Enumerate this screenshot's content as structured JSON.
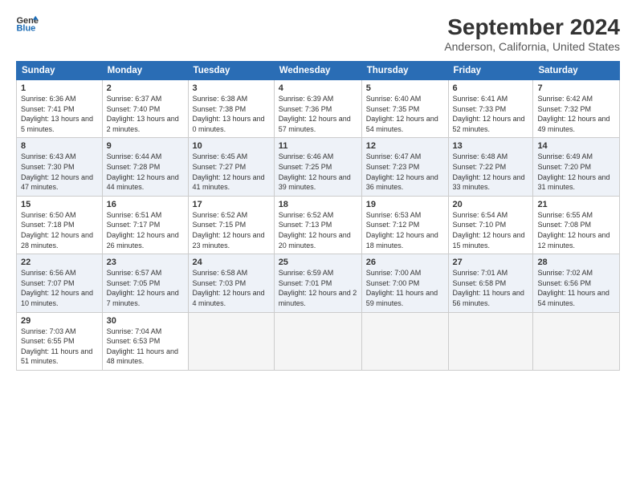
{
  "header": {
    "logo_line1": "General",
    "logo_line2": "Blue",
    "title": "September 2024",
    "subtitle": "Anderson, California, United States"
  },
  "days_of_week": [
    "Sunday",
    "Monday",
    "Tuesday",
    "Wednesday",
    "Thursday",
    "Friday",
    "Saturday"
  ],
  "weeks": [
    [
      {
        "num": "1",
        "sunrise": "Sunrise: 6:36 AM",
        "sunset": "Sunset: 7:41 PM",
        "daylight": "Daylight: 13 hours and 5 minutes."
      },
      {
        "num": "2",
        "sunrise": "Sunrise: 6:37 AM",
        "sunset": "Sunset: 7:40 PM",
        "daylight": "Daylight: 13 hours and 2 minutes."
      },
      {
        "num": "3",
        "sunrise": "Sunrise: 6:38 AM",
        "sunset": "Sunset: 7:38 PM",
        "daylight": "Daylight: 13 hours and 0 minutes."
      },
      {
        "num": "4",
        "sunrise": "Sunrise: 6:39 AM",
        "sunset": "Sunset: 7:36 PM",
        "daylight": "Daylight: 12 hours and 57 minutes."
      },
      {
        "num": "5",
        "sunrise": "Sunrise: 6:40 AM",
        "sunset": "Sunset: 7:35 PM",
        "daylight": "Daylight: 12 hours and 54 minutes."
      },
      {
        "num": "6",
        "sunrise": "Sunrise: 6:41 AM",
        "sunset": "Sunset: 7:33 PM",
        "daylight": "Daylight: 12 hours and 52 minutes."
      },
      {
        "num": "7",
        "sunrise": "Sunrise: 6:42 AM",
        "sunset": "Sunset: 7:32 PM",
        "daylight": "Daylight: 12 hours and 49 minutes."
      }
    ],
    [
      {
        "num": "8",
        "sunrise": "Sunrise: 6:43 AM",
        "sunset": "Sunset: 7:30 PM",
        "daylight": "Daylight: 12 hours and 47 minutes."
      },
      {
        "num": "9",
        "sunrise": "Sunrise: 6:44 AM",
        "sunset": "Sunset: 7:28 PM",
        "daylight": "Daylight: 12 hours and 44 minutes."
      },
      {
        "num": "10",
        "sunrise": "Sunrise: 6:45 AM",
        "sunset": "Sunset: 7:27 PM",
        "daylight": "Daylight: 12 hours and 41 minutes."
      },
      {
        "num": "11",
        "sunrise": "Sunrise: 6:46 AM",
        "sunset": "Sunset: 7:25 PM",
        "daylight": "Daylight: 12 hours and 39 minutes."
      },
      {
        "num": "12",
        "sunrise": "Sunrise: 6:47 AM",
        "sunset": "Sunset: 7:23 PM",
        "daylight": "Daylight: 12 hours and 36 minutes."
      },
      {
        "num": "13",
        "sunrise": "Sunrise: 6:48 AM",
        "sunset": "Sunset: 7:22 PM",
        "daylight": "Daylight: 12 hours and 33 minutes."
      },
      {
        "num": "14",
        "sunrise": "Sunrise: 6:49 AM",
        "sunset": "Sunset: 7:20 PM",
        "daylight": "Daylight: 12 hours and 31 minutes."
      }
    ],
    [
      {
        "num": "15",
        "sunrise": "Sunrise: 6:50 AM",
        "sunset": "Sunset: 7:18 PM",
        "daylight": "Daylight: 12 hours and 28 minutes."
      },
      {
        "num": "16",
        "sunrise": "Sunrise: 6:51 AM",
        "sunset": "Sunset: 7:17 PM",
        "daylight": "Daylight: 12 hours and 26 minutes."
      },
      {
        "num": "17",
        "sunrise": "Sunrise: 6:52 AM",
        "sunset": "Sunset: 7:15 PM",
        "daylight": "Daylight: 12 hours and 23 minutes."
      },
      {
        "num": "18",
        "sunrise": "Sunrise: 6:52 AM",
        "sunset": "Sunset: 7:13 PM",
        "daylight": "Daylight: 12 hours and 20 minutes."
      },
      {
        "num": "19",
        "sunrise": "Sunrise: 6:53 AM",
        "sunset": "Sunset: 7:12 PM",
        "daylight": "Daylight: 12 hours and 18 minutes."
      },
      {
        "num": "20",
        "sunrise": "Sunrise: 6:54 AM",
        "sunset": "Sunset: 7:10 PM",
        "daylight": "Daylight: 12 hours and 15 minutes."
      },
      {
        "num": "21",
        "sunrise": "Sunrise: 6:55 AM",
        "sunset": "Sunset: 7:08 PM",
        "daylight": "Daylight: 12 hours and 12 minutes."
      }
    ],
    [
      {
        "num": "22",
        "sunrise": "Sunrise: 6:56 AM",
        "sunset": "Sunset: 7:07 PM",
        "daylight": "Daylight: 12 hours and 10 minutes."
      },
      {
        "num": "23",
        "sunrise": "Sunrise: 6:57 AM",
        "sunset": "Sunset: 7:05 PM",
        "daylight": "Daylight: 12 hours and 7 minutes."
      },
      {
        "num": "24",
        "sunrise": "Sunrise: 6:58 AM",
        "sunset": "Sunset: 7:03 PM",
        "daylight": "Daylight: 12 hours and 4 minutes."
      },
      {
        "num": "25",
        "sunrise": "Sunrise: 6:59 AM",
        "sunset": "Sunset: 7:01 PM",
        "daylight": "Daylight: 12 hours and 2 minutes."
      },
      {
        "num": "26",
        "sunrise": "Sunrise: 7:00 AM",
        "sunset": "Sunset: 7:00 PM",
        "daylight": "Daylight: 11 hours and 59 minutes."
      },
      {
        "num": "27",
        "sunrise": "Sunrise: 7:01 AM",
        "sunset": "Sunset: 6:58 PM",
        "daylight": "Daylight: 11 hours and 56 minutes."
      },
      {
        "num": "28",
        "sunrise": "Sunrise: 7:02 AM",
        "sunset": "Sunset: 6:56 PM",
        "daylight": "Daylight: 11 hours and 54 minutes."
      }
    ],
    [
      {
        "num": "29",
        "sunrise": "Sunrise: 7:03 AM",
        "sunset": "Sunset: 6:55 PM",
        "daylight": "Daylight: 11 hours and 51 minutes."
      },
      {
        "num": "30",
        "sunrise": "Sunrise: 7:04 AM",
        "sunset": "Sunset: 6:53 PM",
        "daylight": "Daylight: 11 hours and 48 minutes."
      },
      null,
      null,
      null,
      null,
      null
    ]
  ]
}
